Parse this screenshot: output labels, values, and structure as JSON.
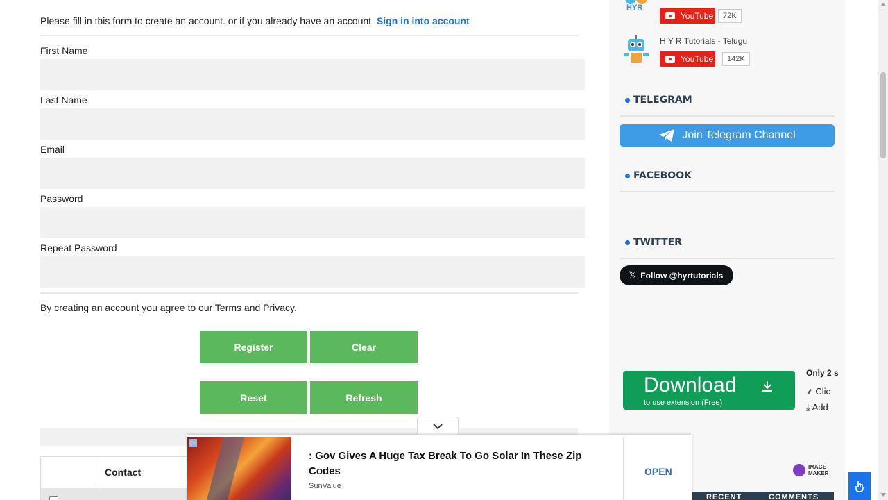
{
  "form": {
    "intro_text": "Please fill in this form to create an account. or if you already have an account",
    "signin_link": "Sign in into account",
    "labels": {
      "first_name": "First Name",
      "last_name": "Last Name",
      "email": "Email",
      "password": "Password",
      "repeat_password": "Repeat Password"
    },
    "terms": "By creating an account you agree to our Terms and Privacy.",
    "buttons": {
      "register": "Register",
      "clear": "Clear",
      "reset": "Reset",
      "refresh": "Refresh"
    }
  },
  "table": {
    "header_contact": "Contact"
  },
  "sidebar": {
    "youtube": [
      {
        "logo_text": "HYR",
        "name": "",
        "button": "YouTube",
        "count": "72K"
      },
      {
        "logo_text": "",
        "name": "H Y R Tutorials - Telugu",
        "button": "YouTube",
        "count": "142K"
      }
    ],
    "sections": {
      "telegram": "TELEGRAM",
      "facebook": "FACEBOOK",
      "twitter": "TWITTER"
    },
    "telegram_button": "Join Telegram Channel",
    "twitter_button": "Follow @hyrtutorials",
    "download_ad": {
      "title": "Download",
      "subtitle": "to use extension (Free)",
      "notes": [
        "Only 2 s",
        "Clic",
        "Add"
      ]
    },
    "image_maker": [
      "IMAGE",
      "MAKER"
    ],
    "tabs": [
      "RECENT",
      "COMMENTS"
    ]
  },
  "bottom_ad": {
    "headline": ": Gov Gives A Huge Tax Break To Go Solar In These Zip Codes",
    "source": "SunValue",
    "cta": "OPEN"
  },
  "colors": {
    "link": "#1a73e8",
    "button_green": "#5cb85c",
    "telegram": "#3e9ce7",
    "youtube": "#e62117",
    "download_green": "#0f9d58"
  }
}
